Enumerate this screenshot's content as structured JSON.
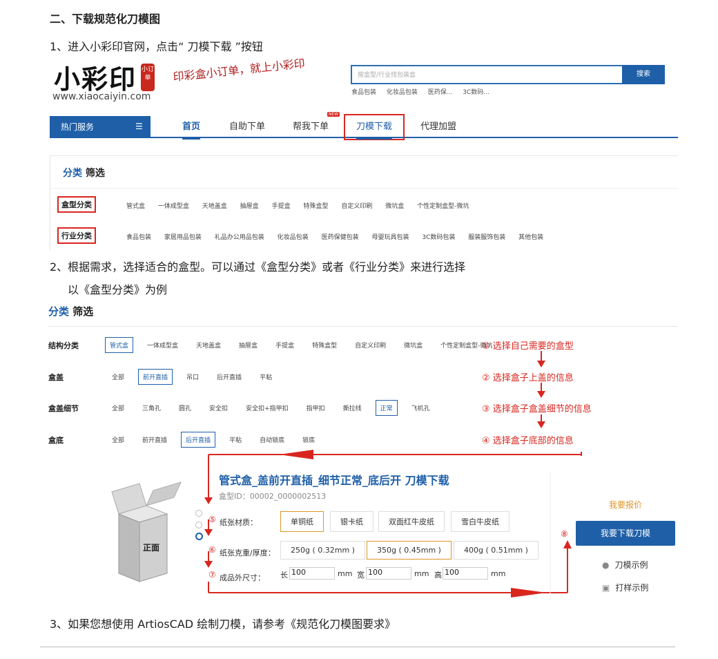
{
  "heading": "二、下载规范化刀模图",
  "step1": "1、进入小彩印官网，点击“ 刀模下载 ”按钮",
  "step2a": "2、根据需求，选择适合的盒型。可以通过《盒型分类》或者《行业分类》来进行选择",
  "step2b": "以《盒型分类》为例",
  "step3": "3、如果您想使用 ArtiosCAD 绘制刀模，请参考《规范化刀模图要求》",
  "site": {
    "logo": "小彩印",
    "seal": "小订单",
    "url": "www.xiaocaiyin.com",
    "slogan": "印彩盒小订单，就上小彩印",
    "search_placeholder": "按盒型/行业找包装盒",
    "search_btn": "搜索",
    "hot_tags": [
      "食品包装",
      "化妆品包装",
      "医药保...",
      "3C数码..."
    ],
    "nav_hot": "热门服务",
    "nav": [
      "首页",
      "自助下单",
      "帮我下单",
      "刀模下载",
      "代理加盟"
    ],
    "new_badge": "NEW",
    "filter_title_a": "分类",
    "filter_title_b": "筛选",
    "box_cat_label": "盒型分类",
    "box_cats": [
      "管式盒",
      "一体成型盒",
      "天地盖盒",
      "抽屉盒",
      "手提盒",
      "特殊盒型",
      "自定义印刷",
      "微坑盒",
      "个性定制盒型-微坑"
    ],
    "ind_cat_label": "行业分类",
    "ind_cats": [
      "食品包装",
      "家居用品包装",
      "礼品办公用品包装",
      "化妆品包装",
      "医药保健包装",
      "母婴玩具包装",
      "3C数码包装",
      "服装服饰包装",
      "其他包装"
    ]
  },
  "filter2": {
    "title_a": "分类",
    "title_b": "筛选",
    "rows": [
      {
        "label": "结构分类",
        "opts": [
          "管式盒",
          "一体成型盒",
          "天地盖盒",
          "抽屉盒",
          "手提盒",
          "特殊盒型",
          "自定义印刷",
          "微坑盒",
          "个性定制盒型-微坑"
        ]
      },
      {
        "label": "盒盖",
        "opts": [
          "全部",
          "前开直插",
          "吊口",
          "后开直插",
          "平粘"
        ]
      },
      {
        "label": "盒盖细节",
        "opts": [
          "全部",
          "三角孔",
          "圆孔",
          "安全扣",
          "安全扣+指甲扣",
          "指甲扣",
          "撕拉线",
          "正常",
          "飞机孔"
        ]
      },
      {
        "label": "盒底",
        "opts": [
          "全部",
          "前开直插",
          "后开直插",
          "平粘",
          "自动锁底",
          "锁底"
        ]
      }
    ],
    "annotations": [
      "① 选择自己需要的盒型",
      "② 选择盒子上盖的信息",
      "③ 选择盒子盒盖细节的信息",
      "④ 选择盒子底部的信息"
    ]
  },
  "product": {
    "title": "管式盒_盖前开直插_细节正常_底后开 刀模下载",
    "id": "盒型ID：00002_0000002513",
    "box_face": "正面",
    "mat_num": "⑤",
    "mat_label": "纸张材质：",
    "materials": [
      "单铜纸",
      "银卡纸",
      "双面红牛皮纸",
      "雪白牛皮纸"
    ],
    "wt_num": "⑥",
    "wt_label": "纸张克重/厚度：",
    "weights": [
      "250g ( 0.32mm )",
      "350g ( 0.45mm )",
      "400g ( 0.51mm )"
    ],
    "sz_num": "⑦",
    "sz_label": "成品外尺寸：",
    "len_label": "长",
    "len": "100",
    "wid_label": "宽",
    "wid": "100",
    "hgt_label": "高",
    "hgt": "100",
    "unit": "mm",
    "quote": "我要报价",
    "dl_num": "⑧",
    "download": "我要下载刀模",
    "example1": "刀模示例",
    "example2": "打样示例"
  }
}
